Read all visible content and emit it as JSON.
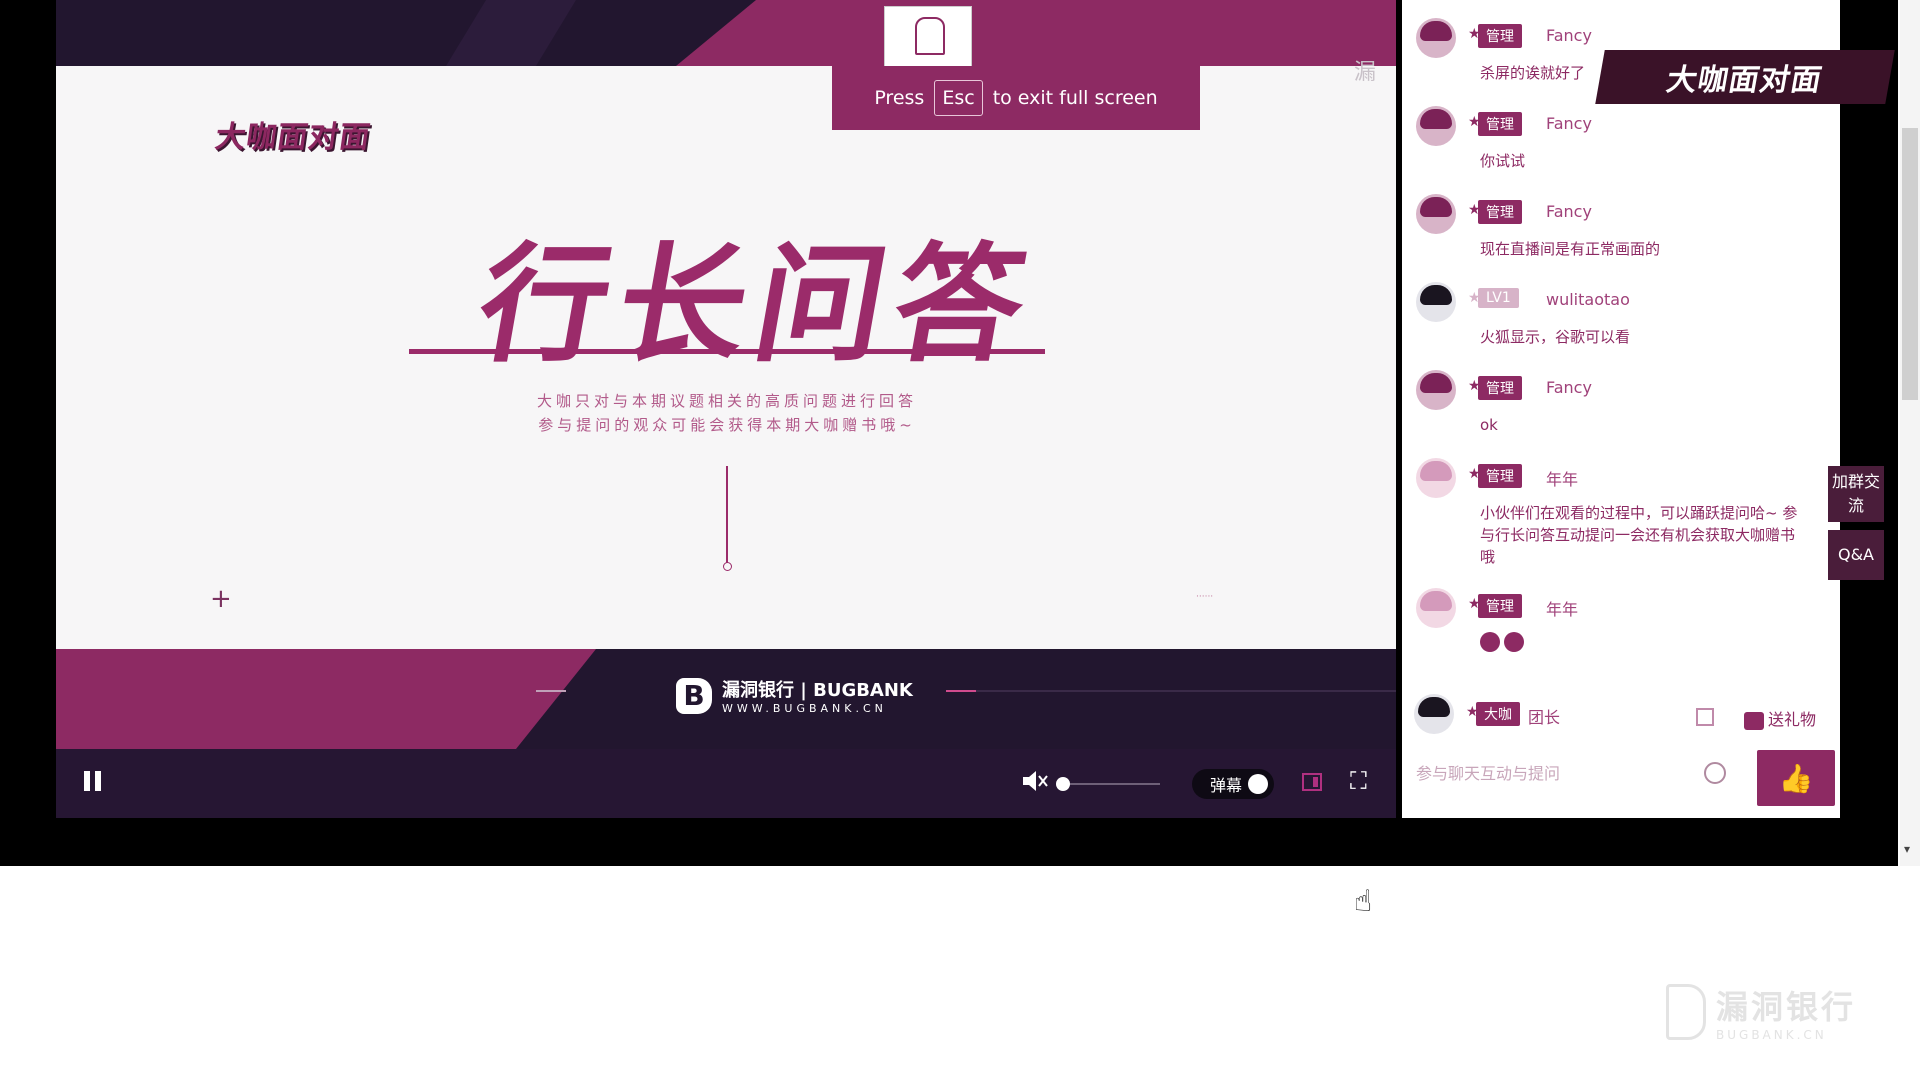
{
  "fullscreen_notice": {
    "press": "Press",
    "key": "Esc",
    "rest": "to exit full screen"
  },
  "slide": {
    "brand": "大咖面对面",
    "title": "行长问答",
    "line1": "大咖只对与本期议题相关的高质问题进行回答",
    "line2": "参与提问的观众可能会获得本期大咖赠书哦~"
  },
  "banner": {
    "name": "漏洞银行 | BUGBANK",
    "url": "WWW.BUGBANK.CN"
  },
  "player": {
    "danmu_label": "弹幕",
    "volume_level": 0
  },
  "colors": {
    "brand": "#8d2a63",
    "dark": "#22162f"
  },
  "chat": {
    "header_logo": "大咖面对面",
    "messages": [
      {
        "badge": "管理",
        "user": "Fancy",
        "text": "杀屏的诶就好了"
      },
      {
        "badge": "管理",
        "user": "Fancy",
        "text": "你试试"
      },
      {
        "badge": "管理",
        "user": "Fancy",
        "text": "现在直播间是有正常画面的"
      },
      {
        "badge": "LV1",
        "user": "wulitaotao",
        "text": "火狐显示，谷歌可以看"
      },
      {
        "badge": "管理",
        "user": "Fancy",
        "text": "ok"
      },
      {
        "badge": "管理",
        "user": "年年",
        "text": "小伙伴们在观看的过程中，可以踊跃提问哈~ 参与行长问答互动提问一会还有机会获取大咖赠书哦"
      },
      {
        "badge": "管理",
        "user": "年年",
        "text": ""
      }
    ],
    "side_buttons": {
      "join": "加群交流",
      "qa": "Q&A"
    },
    "captain": {
      "badge": "大咖",
      "user": "团长"
    },
    "gift": "送礼物",
    "input_placeholder": "参与聊天互动与提问"
  },
  "corner_logo": {
    "name": "漏洞银行",
    "url": "BUGBANK.CN"
  },
  "icons": [
    "pause-icon",
    "mute-icon",
    "pip-icon",
    "fullscreen-icon",
    "thumbs-up-icon",
    "gift-icon",
    "emoji-icon",
    "list-icon"
  ]
}
